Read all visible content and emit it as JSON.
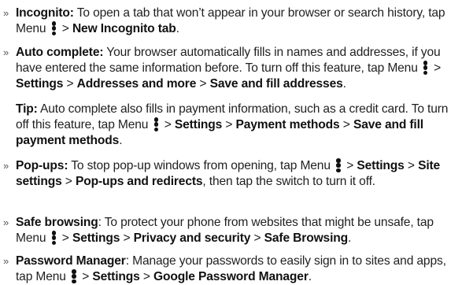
{
  "bullet_glyph": "»",
  "gt": ">",
  "icon": "three-dot-menu-icon",
  "incognito": {
    "term": "Incognito:",
    "text1": " To open a tab that won’t appear in your browser or search history, tap Menu ",
    "path1": "New Incognito tab",
    "end": "."
  },
  "autocomplete": {
    "term": "Auto complete:",
    "text1": " Your browser automatically fills in names and addresses, if you have entered the same information before. To turn off this feature, tap Menu ",
    "path1": "Settings",
    "path2": "Addresses and more",
    "path3": "Save and fill addresses",
    "end": "."
  },
  "tip": {
    "term": "Tip:",
    "text1": " Auto complete also fills in payment information, such as a credit card. To turn off this feature, tap Menu ",
    "path1": "Settings",
    "path2": "Payment methods",
    "path3": "Save and fill payment methods",
    "end": "."
  },
  "popups": {
    "term": "Pop-ups:",
    "text1": " To stop pop-up windows from opening, tap Menu ",
    "path1": "Settings",
    "path2": "Site settings",
    "path3": "Pop-ups and redirects",
    "text2": ", then tap the switch to turn it off."
  },
  "safebrowsing": {
    "term": "Safe browsing",
    "text1": ": To protect your phone from websites that might be unsafe, tap Menu ",
    "path1": "Settings",
    "path2": "Privacy and security",
    "path3": "Safe Browsing",
    "end": "."
  },
  "passwords": {
    "term": "Password Manager",
    "text1": ": Manage your passwords to easily sign in to sites and apps, tap Menu ",
    "path1": "Settings",
    "path2": "Google Password Manager",
    "end": "."
  }
}
